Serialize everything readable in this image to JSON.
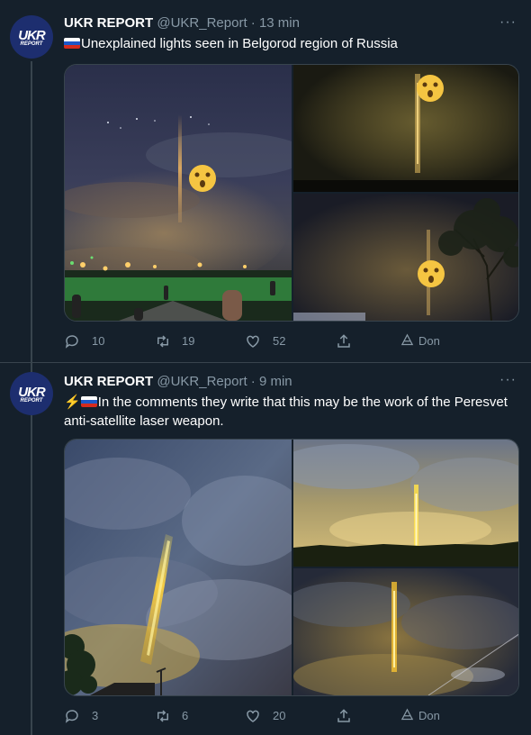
{
  "tweets": [
    {
      "author": {
        "avatar_top": "UKR",
        "avatar_bottom": "REPORT",
        "name": "UKR REPORT",
        "handle": "@UKR_Report",
        "time": "13 min"
      },
      "prefix_icons": [
        "russia-flag-icon"
      ],
      "text": "Unexplained lights seen in Belgorod region of Russia",
      "more_label": "···",
      "media": [
        "night-sky-light-pillar-city",
        "dark-light-pillar-closeup",
        "night-sky-light-pillar-tree"
      ],
      "actions": {
        "replies": "10",
        "retweets": "19",
        "likes": "52",
        "donate_label": "Don"
      }
    },
    {
      "author": {
        "avatar_top": "UKR",
        "avatar_bottom": "REPORT",
        "name": "UKR REPORT",
        "handle": "@UKR_Report",
        "time": "9 min"
      },
      "prefix_icons": [
        "lightning-icon",
        "russia-flag-icon"
      ],
      "bolt": "⚡",
      "text": "In the comments they write that this may be the work of the Peresvet anti-satellite laser weapon.",
      "more_label": "···",
      "media": [
        "cloudy-sky-yellow-beam",
        "dusk-sky-yellow-beam-treeline",
        "night-clouds-yellow-beam"
      ],
      "actions": {
        "replies": "3",
        "retweets": "6",
        "likes": "20",
        "donate_label": "Don"
      }
    }
  ],
  "colors": {
    "background": "#15202b",
    "secondary_text": "#8899a6",
    "border": "#38444d",
    "beam": "#ffd23f"
  }
}
